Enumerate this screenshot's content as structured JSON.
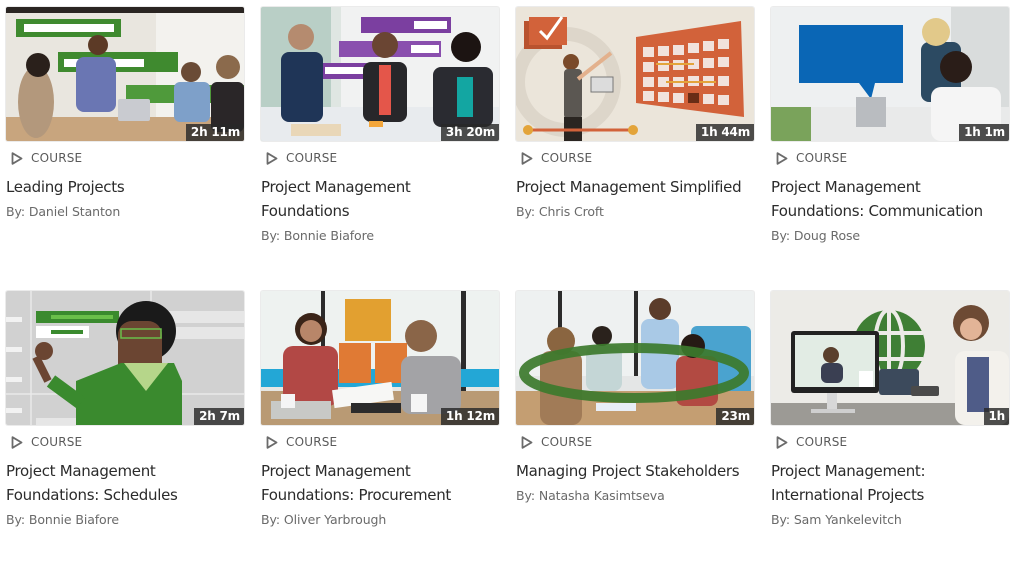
{
  "courses": [
    {
      "type": "COURSE",
      "title": "Leading Projects",
      "author": "By: Daniel Stanton",
      "duration": "2h 11m",
      "thumbnail": "photo-meeting-green-gantt-overlay",
      "accent": "#3f8a2f"
    },
    {
      "type": "COURSE",
      "title": "Project Management Foundations",
      "author": "By: Bonnie Biafore",
      "duration": "3h 20m",
      "thumbnail": "photo-meeting-purple-gantt-overlay",
      "accent": "#7b3fa0"
    },
    {
      "type": "COURSE",
      "title": "Project Management Simplified",
      "author": "By: Chris Croft",
      "duration": "1h 44m",
      "thumbnail": "illustration-calendar-orange",
      "accent": "#d2623a"
    },
    {
      "type": "COURSE",
      "title": "Project Management Foundations: Communication",
      "author": "By: Doug Rose",
      "duration": "1h 1m",
      "thumbnail": "photo-office-blue-speech-bubble",
      "accent": "#0a66b5"
    },
    {
      "type": "COURSE",
      "title": "Project Management Foundations: Schedules",
      "author": "By: Bonnie Biafore",
      "duration": "2h 7m",
      "thumbnail": "illustration-presenter-schedule-green",
      "accent": "#3a8a2e"
    },
    {
      "type": "COURSE",
      "title": "Project Management Foundations: Procurement",
      "author": "By: Oliver Yarbrough",
      "duration": "1h 12m",
      "thumbnail": "photo-meeting-orange-squares",
      "accent": "#e2a030"
    },
    {
      "type": "COURSE",
      "title": "Managing Project Stakeholders",
      "author": "By: Natasha Kasimtseva",
      "duration": "23m",
      "thumbnail": "photo-team-green-ring",
      "accent": "#3c7a2c"
    },
    {
      "type": "COURSE",
      "title": "Project Management: International Projects",
      "author": "By: Sam Yankelevitch",
      "duration": "1h",
      "thumbnail": "photo-video-call-green-globe",
      "accent": "#3f7f35"
    }
  ]
}
